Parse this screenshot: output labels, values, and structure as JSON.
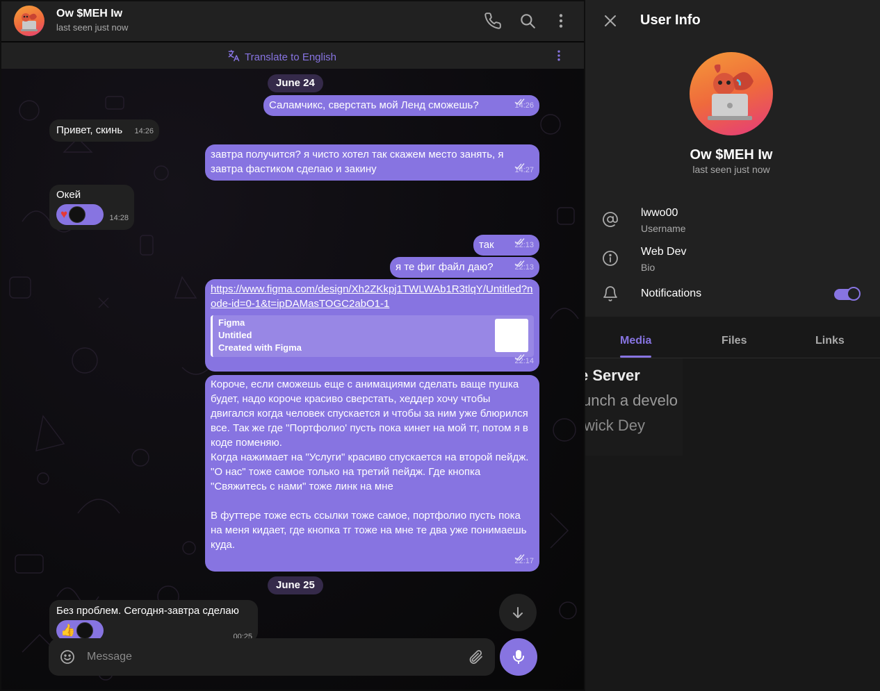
{
  "chat": {
    "header": {
      "name": "Ow $MEH Iw",
      "status": "last seen just now",
      "icons": [
        "phone-icon",
        "search-icon",
        "more-vertical-icon"
      ]
    },
    "translate": {
      "label": "Translate to English",
      "icon": "translate-icon"
    },
    "dates": {
      "first": "June 24",
      "second": "June 25"
    },
    "messages": {
      "m1": {
        "text": "Саламчикс, сверстать мой Ленд сможешь?",
        "time": "14:26"
      },
      "m2": {
        "text": "Привет, скинь",
        "time": "14:26"
      },
      "m3": {
        "text": "завтра получится? я чисто хотел так скажем место занять, я завтра фастиком сделаю и закину",
        "time": "14:27"
      },
      "m4": {
        "text": "Окей",
        "time": "14:28",
        "reaction": "♥"
      },
      "m5": {
        "text": "так",
        "time": "22:13"
      },
      "m6": {
        "text": "я те фиг файл даю?",
        "time": "22:13"
      },
      "m7": {
        "link": "https://www.figma.com/design/Xh2ZKkpj1TWLWAb1R3tlqY/Untitled?node-id=0-1&t=ipDAMasTOGC2abO1-1",
        "preview_site": "Figma",
        "preview_title": "Untitled",
        "preview_desc": "Created with Figma",
        "time": "22:14"
      },
      "m8": {
        "p1": "Короче, если сможешь еще с анимациями сделать ваще пушка будет, надо короче красиво сверстать, хеддер хочу чтобы двигался когда человек спускается и чтобы за ним уже блюрился все. Так же где \"Портфолио' пусть пока кинет на мой тг, потом я в коде поменяю.",
        "p2": "Когда нажимает на \"Услуги\" красиво спускается на второй пейдж.",
        "p3": "\"О нас\" тоже самое только на третий пейдж. Где кнопка \"Свяжитесь с нами\" тоже линк на мне",
        "p4": "В футтере тоже есть ссылки тоже самое, портфолио пусть пока на меня кидает, где кнопка тг тоже на мне те два уже понимаешь куда.",
        "time": "22:17"
      },
      "m9": {
        "text": "Без проблем. Сегодня-завтра сделаю",
        "time": "00:25",
        "reaction": "👍"
      }
    },
    "composer": {
      "placeholder": "Message"
    }
  },
  "panel": {
    "title": "User Info",
    "name": "Ow $MEH Iw",
    "status": "last seen just now",
    "username": {
      "value": "lwwo00",
      "label": "Username"
    },
    "bio": {
      "value": "Web Dev",
      "label": "Bio"
    },
    "notifications": {
      "label": "Notifications",
      "enabled": true
    },
    "tabs": [
      "Media",
      "Files",
      "Links"
    ],
    "active_tab": "Media",
    "media_thumb": {
      "line1": "e Server",
      "line2": "unch a develo",
      "line3": "wick Dey"
    }
  },
  "colors": {
    "accent": "#8774e1",
    "background": "#212121",
    "incoming_bubble": "#212121",
    "outgoing_bubble": "#8774e1",
    "secondary_text": "#aaaaaa"
  }
}
